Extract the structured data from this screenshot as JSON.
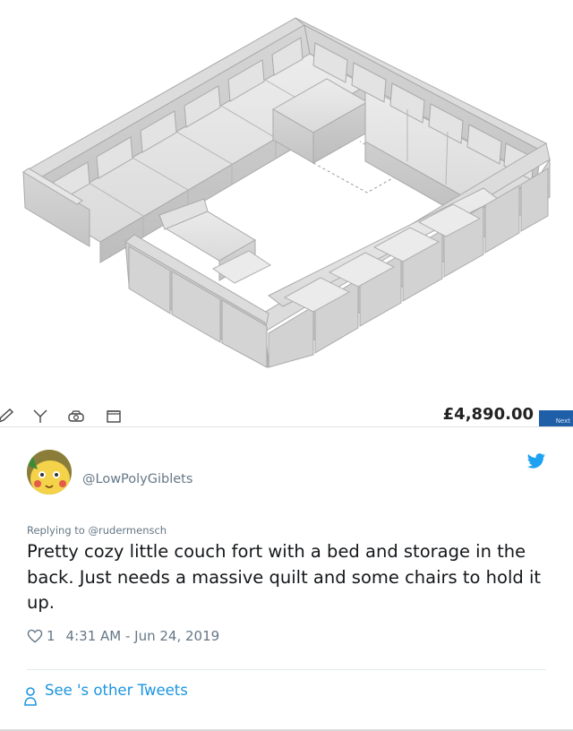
{
  "product": {
    "image_alt": "",
    "toolbar_icons": [
      "pencil-icon",
      "measure-icon",
      "camera-icon",
      "calendar-icon"
    ],
    "price": "£4,890.00",
    "next_label": "Next"
  },
  "tweet": {
    "handle": "@LowPolyGiblets",
    "replying_prefix": "Replying to ",
    "replying_to": "@rudermensch",
    "text": "Pretty cozy little couch fort with a bed and storage in the back. Just needs a massive quilt and some chairs to hold it up.",
    "like_count": "1",
    "timestamp": "4:31 AM - Jun 24, 2019",
    "see_other_tweets": "See 's other Tweets",
    "colors": {
      "link": "#1b95e0",
      "twitter_blue": "#1da1f2",
      "muted": "#657786"
    }
  }
}
